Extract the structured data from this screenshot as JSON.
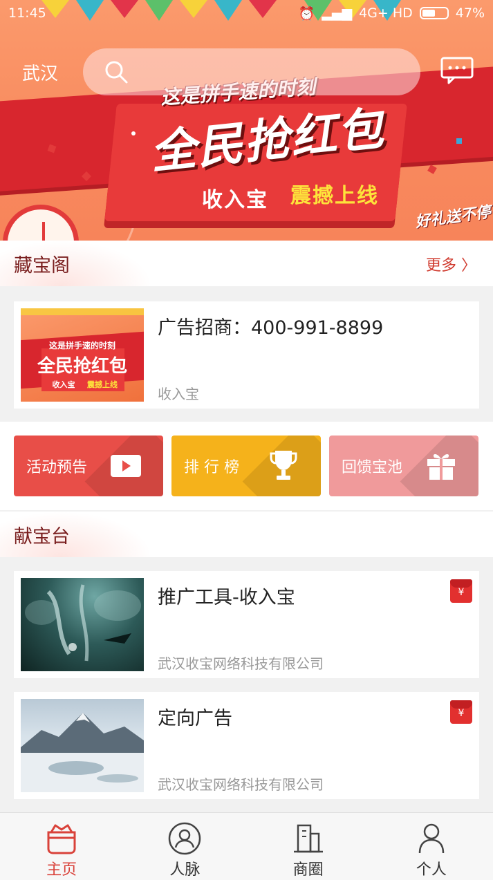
{
  "status_bar": {
    "time": "11:45",
    "network": "4G+ HD",
    "battery": "47%"
  },
  "header": {
    "city": "武汉"
  },
  "banner": {
    "subtitle": "这是拼手速的时刻",
    "main": "全民抢红包",
    "product": "收入宝",
    "online": "震撼上线",
    "tag": "好礼送不停"
  },
  "treasure_section": {
    "title": "藏宝阁",
    "more_label": "更多",
    "card": {
      "title": "广告招商：400-991-8899",
      "subtitle": "收入宝"
    }
  },
  "actions": [
    {
      "label": "活动预告",
      "color": "#e84e48",
      "icon": "play-icon"
    },
    {
      "label": "排 行 榜",
      "color": "#f5b21b",
      "icon": "trophy-icon"
    },
    {
      "label": "回馈宝池",
      "color": "#f09a9b",
      "icon": "gift-icon"
    }
  ],
  "offer_section": {
    "title": "献宝台",
    "items": [
      {
        "title": "推广工具-收入宝",
        "company": "武汉收宝网络科技有限公司",
        "badge_icon": "red-packet-icon"
      },
      {
        "title": "定向广告",
        "company": "武汉收宝网络科技有限公司",
        "badge_icon": "red-packet-icon"
      }
    ]
  },
  "bottom_nav": [
    {
      "label": "主页",
      "icon": "home-icon",
      "active": true
    },
    {
      "label": "人脉",
      "icon": "contacts-icon",
      "active": false
    },
    {
      "label": "商圈",
      "icon": "buildings-icon",
      "active": false
    },
    {
      "label": "个人",
      "icon": "person-icon",
      "active": false
    }
  ],
  "colors": {
    "accent": "#d9423a",
    "banner_bg": "#f88a5e",
    "title_red": "#7a1f1f"
  }
}
